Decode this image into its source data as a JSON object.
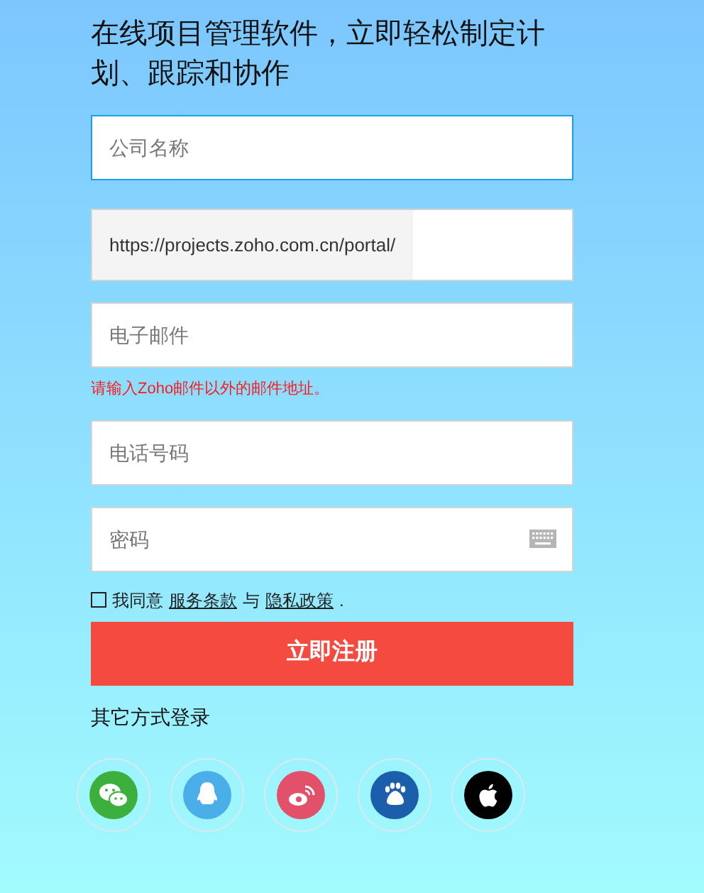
{
  "heading": "在线项目管理软件，立即轻松制定计划、跟踪和协作",
  "fields": [
    {
      "kind": "text",
      "placeholder": "公司名称",
      "focused": true
    },
    {
      "kind": "url",
      "value": "https://projects.zoho.com.cn/portal/",
      "focused": false
    },
    {
      "kind": "text",
      "placeholder": "电子邮件",
      "focused": false,
      "error": "请输入Zoho邮件以外的邮件地址。"
    },
    {
      "kind": "text",
      "placeholder": "电话号码",
      "focused": false
    },
    {
      "kind": "password",
      "placeholder": "密码",
      "focused": false
    }
  ],
  "agreement": {
    "checked": false,
    "parts": [
      {
        "kind": "text",
        "text": "我同意"
      },
      {
        "kind": "link",
        "text": "服务条款"
      },
      {
        "kind": "text",
        "text": "与"
      },
      {
        "kind": "link",
        "text": "隐私政策"
      },
      {
        "kind": "text",
        "text": "."
      }
    ]
  },
  "submit_button": "立即注册",
  "other_login": "其它方式登录",
  "social_logins": [
    {
      "kind": "wechat",
      "color": "#3daf3c"
    },
    {
      "kind": "qq",
      "color": "#4aaee8"
    },
    {
      "kind": "weibo",
      "color": "#e2506a"
    },
    {
      "kind": "baidu",
      "color": "#1b5fac"
    },
    {
      "kind": "apple",
      "color": "#000000"
    }
  ]
}
